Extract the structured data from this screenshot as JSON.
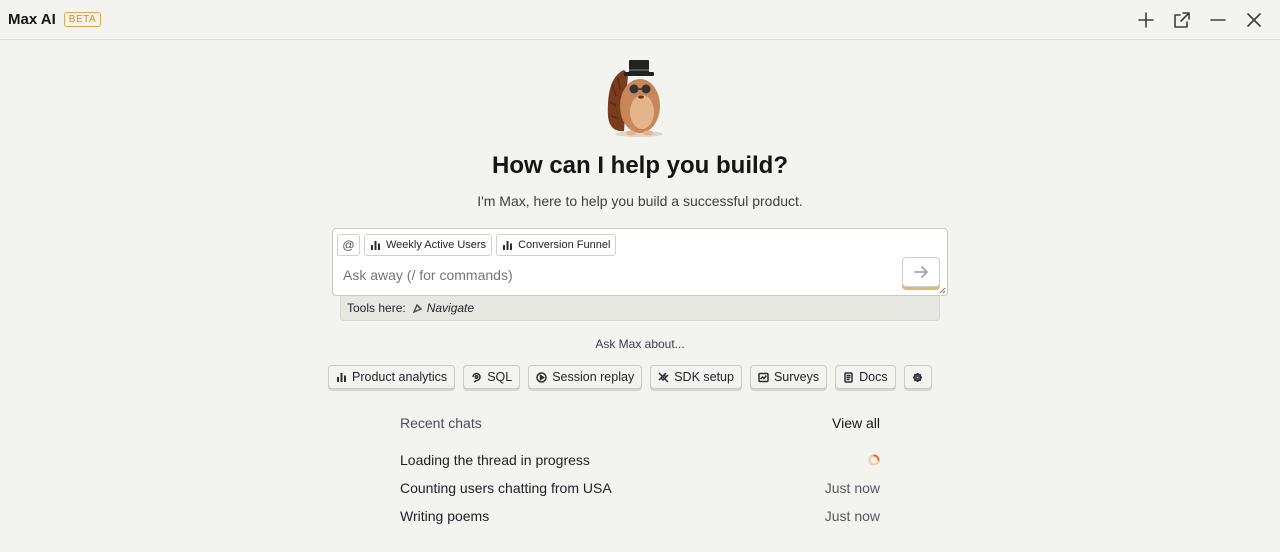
{
  "header": {
    "title": "Max AI",
    "badge": "BETA",
    "actions": [
      "plus-icon",
      "open-in-new-icon",
      "minimize-icon",
      "close-icon"
    ]
  },
  "hero": {
    "heading": "How can I help you build?",
    "subheading": "I'm Max, here to help you build a successful product."
  },
  "input": {
    "mention_label": "@",
    "context_chips": [
      {
        "label": "Weekly Active Users",
        "icon": "bar-chart-icon"
      },
      {
        "label": "Conversion Funnel",
        "icon": "bar-chart-icon"
      }
    ],
    "placeholder": "Ask away (/ for commands)",
    "send_icon": "arrow-right-icon"
  },
  "tools": {
    "label": "Tools here:",
    "items": [
      {
        "label": "Navigate",
        "icon": "compass-icon"
      }
    ]
  },
  "suggestions": {
    "title": "Ask Max about...",
    "items": [
      {
        "label": "Product analytics",
        "icon": "bar-chart-icon"
      },
      {
        "label": "SQL",
        "icon": "database-icon"
      },
      {
        "label": "Session replay",
        "icon": "play-icon"
      },
      {
        "label": "SDK setup",
        "icon": "plug-icon"
      },
      {
        "label": "Surveys",
        "icon": "survey-icon"
      },
      {
        "label": "Docs",
        "icon": "document-icon"
      }
    ],
    "settings_icon": "gear-icon"
  },
  "recent": {
    "title": "Recent chats",
    "view_all": "View all",
    "chats": [
      {
        "title": "Loading the thread in progress",
        "time": "",
        "status": "loading"
      },
      {
        "title": "Counting users chatting from USA",
        "time": "Just now"
      },
      {
        "title": "Writing poems",
        "time": "Just now"
      }
    ]
  },
  "colors": {
    "background": "#f3f3ef",
    "accent": "#e3b773",
    "beta": "#d98c1a",
    "spinner": "#f26b1d"
  }
}
